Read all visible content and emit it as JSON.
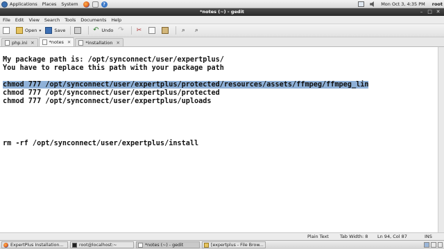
{
  "top_panel": {
    "menus": [
      "Applications",
      "Places",
      "System"
    ],
    "clock": "Mon Oct 3,  4:35 PM",
    "user": "root"
  },
  "window": {
    "title": "*notes (~) - gedit"
  },
  "menubar": [
    "File",
    "Edit",
    "View",
    "Search",
    "Tools",
    "Documents",
    "Help"
  ],
  "toolbar": {
    "open_label": "Open",
    "save_label": "Save",
    "undo_label": "Undo"
  },
  "tabs": [
    {
      "label": "php.ini",
      "close": "✕"
    },
    {
      "label": "*notes",
      "close": "✕"
    },
    {
      "label": "*installation",
      "close": "✕"
    }
  ],
  "editor": {
    "lines": [
      "My package path is: /opt/synconnect/user/expertplus/",
      "You have to replace this path with your package path",
      "chmod 777 /opt/synconnect/user/expertplus/protected/resources/assets/ffmpeg/ffmpeg_lin",
      "chmod 777 /opt/synconnect/user/expertplus/protected",
      "chmod 777 /opt/synconnect/user/expertplus/uploads",
      "rm -rf /opt/synconnect/user/expertplus/install"
    ]
  },
  "statusbar": {
    "language": "Plain Text",
    "tab_width": "Tab Width:  8",
    "position": "Ln 94, Col 87",
    "mode": "INS"
  },
  "taskbar": [
    "ExpertPlus Installation...",
    "root@localhost:~",
    "*notes (~) - gedit",
    "[expertplus - File Brow..."
  ]
}
